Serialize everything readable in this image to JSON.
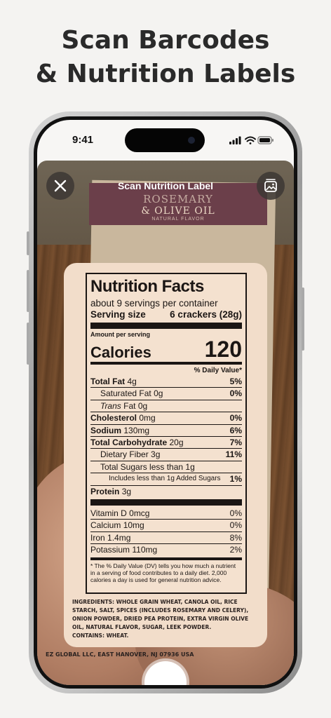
{
  "promo": {
    "title_line1": "Scan Barcodes",
    "title_line2": "& Nutrition Labels"
  },
  "status_bar": {
    "time": "9:41",
    "icons": [
      "cellular-signal-icon",
      "wifi-icon",
      "battery-icon"
    ]
  },
  "scanner": {
    "title": "Scan Nutrition Label",
    "close_icon": "close-icon",
    "gallery_icon": "photo-library-icon",
    "shutter_icon": "shutter-icon"
  },
  "package": {
    "flavor_line1": "ROSEMARY",
    "flavor_line2": "& OLIVE OIL",
    "flavor_line3": "NATURAL FLAVOR",
    "ingredients": "INGREDIENTS: WHOLE GRAIN WHEAT, CANOLA OIL, RICE STARCH, SALT, SPICES (INCLUDES ROSEMARY AND CELERY), ONION POWDER, DRIED PEA PROTEIN, EXTRA VIRGIN OLIVE OIL, NATURAL FLAVOR, SUGAR, LEEK POWDER.",
    "contains": "CONTAINS: WHEAT.",
    "manufacturer": "EZ GLOBAL LLC, EAST HANOVER, NJ 07936 USA"
  },
  "nutrition": {
    "title": "Nutrition Facts",
    "servings": "about 9 servings per container",
    "serving_size_label": "Serving size",
    "serving_size_value": "6 crackers (28g)",
    "amount_per_serving": "Amount per serving",
    "calories_label": "Calories",
    "calories_value": "120",
    "dv_header": "% Daily Value*",
    "rows": [
      {
        "name": "Total Fat",
        "amount": "4g",
        "dv": "5%"
      },
      {
        "name": "Saturated Fat",
        "amount": "0g",
        "dv": "0%"
      },
      {
        "name": "Trans",
        "amount": "Fat 0g",
        "dv": ""
      },
      {
        "name": "Cholesterol",
        "amount": "0mg",
        "dv": "0%"
      },
      {
        "name": "Sodium",
        "amount": "130mg",
        "dv": "6%"
      },
      {
        "name": "Total Carbohydrate",
        "amount": "20g",
        "dv": "7%"
      },
      {
        "name": "Dietary Fiber",
        "amount": "3g",
        "dv": "11%"
      },
      {
        "name": "Total Sugars less than 1g",
        "amount": "",
        "dv": ""
      },
      {
        "name": "Includes less than 1g Added Sugars",
        "amount": "",
        "dv": "1%"
      },
      {
        "name": "Protein",
        "amount": "3g",
        "dv": ""
      }
    ],
    "vitamins": [
      {
        "name": "Vitamin D",
        "amount": "0mcg",
        "dv": "0%"
      },
      {
        "name": "Calcium",
        "amount": "10mg",
        "dv": "0%"
      },
      {
        "name": "Iron",
        "amount": "1.4mg",
        "dv": "8%"
      },
      {
        "name": "Potassium",
        "amount": "110mg",
        "dv": "2%"
      }
    ],
    "footnote": "* The % Daily Value (DV) tells you how much a nutrient in a serving of food contributes to a daily diet. 2,000 calories a day is used for general nutrition advice."
  }
}
